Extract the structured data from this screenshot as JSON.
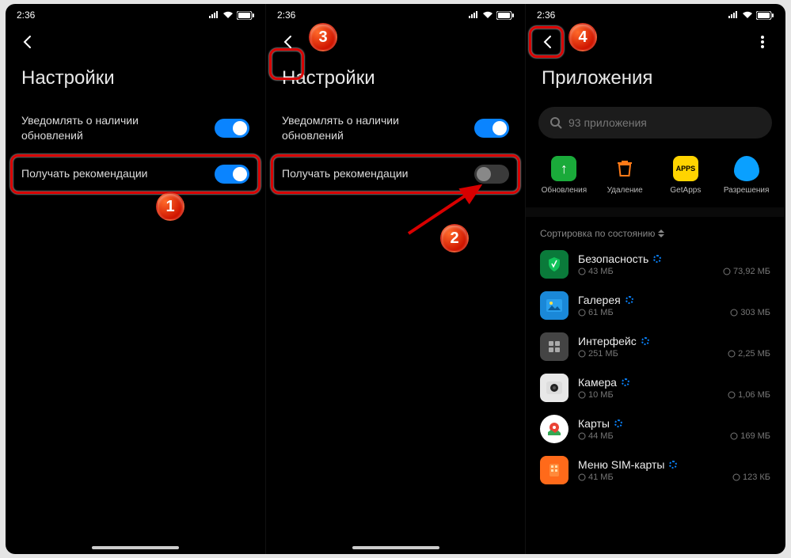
{
  "status": {
    "time": "2:36"
  },
  "pane1": {
    "title": "Настройки",
    "row1": "Уведомлять о наличии обновлений",
    "row2": "Получать рекомендации",
    "badge": "1"
  },
  "pane2": {
    "title": "Настройки",
    "row1": "Уведомлять о наличии обновлений",
    "row2": "Получать рекомендации",
    "badge_back": "3",
    "badge_arrow": "2"
  },
  "pane3": {
    "title": "Приложения",
    "badge_back": "4",
    "search_placeholder": "93 приложения",
    "actions": {
      "updates": "Обновления",
      "delete": "Удаление",
      "getapps": "GetApps",
      "perms": "Разрешения"
    },
    "sort": "Сортировка по состоянию",
    "apps": [
      {
        "name": "Безопасность",
        "s1": "43 МБ",
        "s2": "73,92 МБ"
      },
      {
        "name": "Галерея",
        "s1": "61 МБ",
        "s2": "303 МБ"
      },
      {
        "name": "Интерфейс",
        "s1": "251 МБ",
        "s2": "2,25 МБ"
      },
      {
        "name": "Камера",
        "s1": "10 МБ",
        "s2": "1,06 МБ"
      },
      {
        "name": "Карты",
        "s1": "44 МБ",
        "s2": "169 МБ"
      },
      {
        "name": "Меню SIM-карты",
        "s1": "41 МБ",
        "s2": "123 КБ"
      }
    ]
  }
}
